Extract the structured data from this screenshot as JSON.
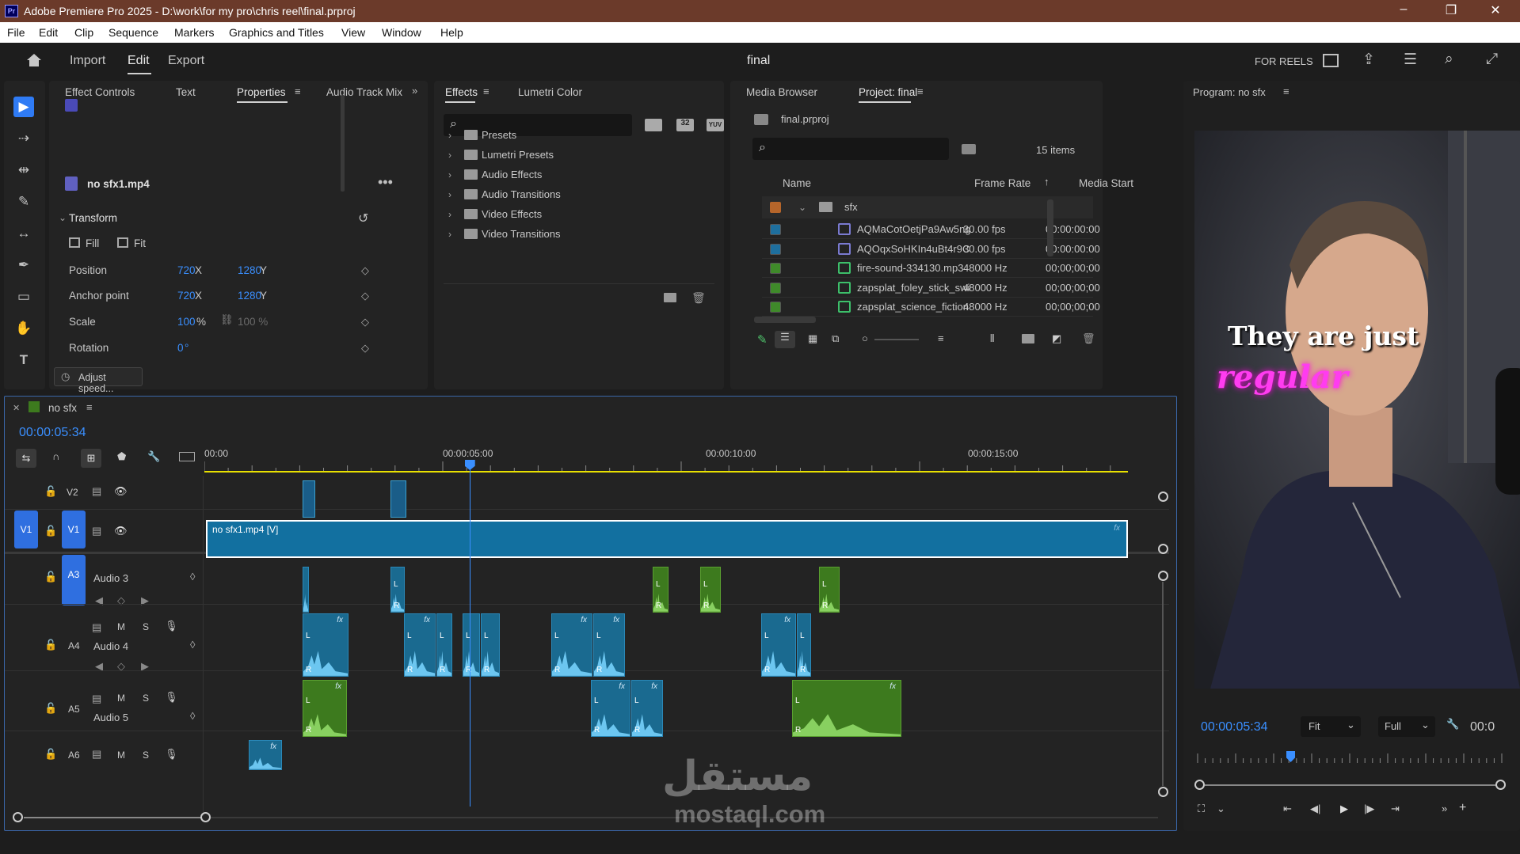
{
  "app": {
    "title": "Adobe Premiere Pro 2025 - D:\\work\\for my pro\\chris reel\\final.prproj",
    "pr_badge": "Pr"
  },
  "menu": [
    "File",
    "Edit",
    "Clip",
    "Sequence",
    "Markers",
    "Graphics and Titles",
    "View",
    "Window",
    "Help"
  ],
  "workspace": {
    "tabs": [
      "Import",
      "Edit",
      "Export"
    ],
    "active": "Edit",
    "project_name": "final",
    "preset": "FOR REELS"
  },
  "effect_controls": {
    "tabs": [
      "Effect Controls",
      "Text",
      "Properties",
      "Audio Track Mix"
    ],
    "active_tab": "Properties",
    "clip_name": "no sfx1.mp4",
    "section": "Transform",
    "fill_label": "Fill",
    "fit_label": "Fit",
    "rows": [
      {
        "label": "Position",
        "v1": "720",
        "u1": "X",
        "v2": "1280",
        "u2": "Y"
      },
      {
        "label": "Anchor point",
        "v1": "720",
        "u1": "X",
        "v2": "1280",
        "u2": "Y"
      },
      {
        "label": "Scale",
        "v1": "100",
        "u1": "%",
        "v2": "100 %",
        "u2": ""
      },
      {
        "label": "Rotation",
        "v1": "0",
        "u1": "°",
        "v2": "",
        "u2": ""
      }
    ],
    "adjust_speed": "Adjust speed..."
  },
  "effects": {
    "tabs": [
      "Effects",
      "Lumetri Color"
    ],
    "active_tab": "Effects",
    "icon_labels": [
      "32",
      "YUV"
    ],
    "items": [
      "Presets",
      "Lumetri Presets",
      "Audio Effects",
      "Audio Transitions",
      "Video Effects",
      "Video Transitions"
    ]
  },
  "project": {
    "tabs": [
      "Media Browser",
      "Project: final"
    ],
    "active_tab": "Project: final",
    "file": "final.prproj",
    "item_count": "15 items",
    "columns": [
      "Name",
      "Frame Rate",
      "Media Start"
    ],
    "folder": {
      "name": "sfx",
      "color": "#b5652a"
    },
    "rows": [
      {
        "name": "AQMaCotOetjPa9Aw5ng",
        "rate": "30.00 fps",
        "start": "00:00:00:00",
        "color": "#1e6f9e",
        "kind": "video"
      },
      {
        "name": "AQOqxSoHKIn4uBt4r9C",
        "rate": "30.00 fps",
        "start": "00:00:00:00",
        "color": "#1e6f9e",
        "kind": "video"
      },
      {
        "name": "fire-sound-334130.mp3",
        "rate": "48000 Hz",
        "start": "00;00;00;00",
        "color": "#3f8a2a",
        "kind": "audio"
      },
      {
        "name": "zapsplat_foley_stick_swi",
        "rate": "48000 Hz",
        "start": "00;00;00;00",
        "color": "#3f8a2a",
        "kind": "audio"
      },
      {
        "name": "zapsplat_science_fiction",
        "rate": "48000 Hz",
        "start": "00;00;00;00",
        "color": "#3f8a2a",
        "kind": "audio"
      }
    ]
  },
  "program": {
    "title": "Program: no sfx",
    "caption_line1": "They are just",
    "caption_line2": "regular",
    "timecode": "00:00:05:34",
    "fit": "Fit",
    "quality": "Full",
    "end_tc": "00:0"
  },
  "timeline": {
    "sequence": "no sfx",
    "timecode": "00:00:05:34",
    "ruler": [
      "00:00",
      "00:00:05:00",
      "00:00:10:00",
      "00:00:15:00"
    ],
    "playhead_seconds": 5.56,
    "tracks": {
      "v2": "V2",
      "v1": "V1",
      "a3": {
        "id": "A3",
        "name": "Audio 3"
      },
      "a4": {
        "id": "A4",
        "name": "Audio 4"
      },
      "a5": {
        "id": "A5",
        "name": "Audio 5"
      },
      "a6": {
        "id": "A6"
      }
    },
    "video_clip": "no sfx1.mp4 [V]",
    "mute": "M",
    "solo": "S",
    "channel_l": "L",
    "channel_r": "R",
    "fx": "fx"
  },
  "watermark": {
    "arabic": "مستقل",
    "latin": "mostaql.com"
  }
}
